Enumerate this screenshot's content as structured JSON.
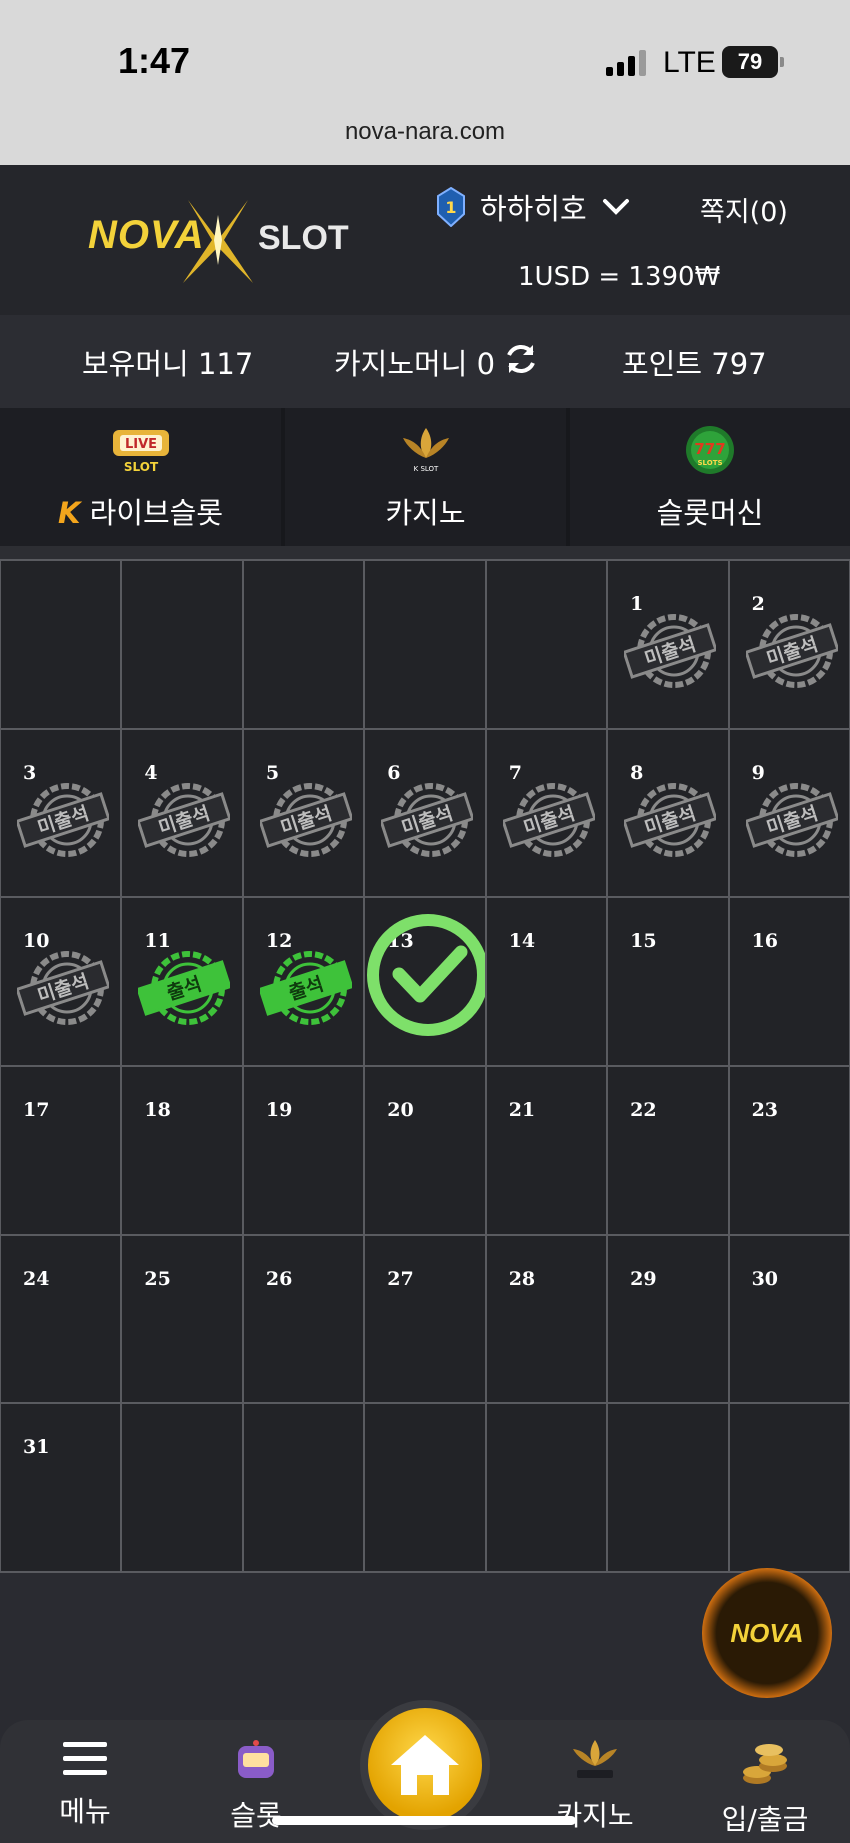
{
  "status_bar": {
    "time": "1:47",
    "network": "LTE",
    "battery": "79",
    "url": "nova-nara.com"
  },
  "header": {
    "logo": {
      "nova": "NOVA",
      "slot": "SLOT"
    },
    "username": "하하히호",
    "level": "1",
    "messages": "쪽지(0)",
    "exchange_rate": "1USD = 1390₩"
  },
  "balances": {
    "holding": "보유머니 117",
    "casino": "카지노머니 0",
    "points": "포인트 797"
  },
  "tabs": [
    {
      "label": "라이브슬롯",
      "icon": "live-slot-icon",
      "icon_text": "LIVE",
      "icon_sub": "SLOT",
      "prefix": "K"
    },
    {
      "label": "카지노",
      "icon": "casino-lotus-icon",
      "icon_sub": "K SLOT"
    },
    {
      "label": "슬롯머신",
      "icon": "slot-777-icon",
      "icon_text": "777",
      "icon_sub": "SLOTS"
    }
  ],
  "calendar": {
    "days": [
      "",
      "",
      "",
      "",
      "",
      "1",
      "2",
      "3",
      "4",
      "5",
      "6",
      "7",
      "8",
      "9",
      "10",
      "11",
      "12",
      "13",
      "14",
      "15",
      "16",
      "17",
      "18",
      "19",
      "20",
      "21",
      "22",
      "23",
      "24",
      "25",
      "26",
      "27",
      "28",
      "29",
      "30",
      "31",
      "",
      "",
      "",
      "",
      "",
      ""
    ],
    "absent_label": "미출석",
    "present_label": "출석",
    "absent_days": [
      "1",
      "2",
      "3",
      "4",
      "5",
      "6",
      "7",
      "8",
      "9",
      "10"
    ],
    "present_days": [
      "11",
      "12"
    ],
    "today": "13"
  },
  "fab": {
    "label": "NOVA"
  },
  "bottom_nav": {
    "menu": "메뉴",
    "slot": "슬롯",
    "casino": "카지노",
    "deposit": "입/출금"
  },
  "colors": {
    "accent": "#f3d23a",
    "present": "#3ec23a",
    "absent": "#8a8a8a",
    "check": "#7ee06a"
  }
}
